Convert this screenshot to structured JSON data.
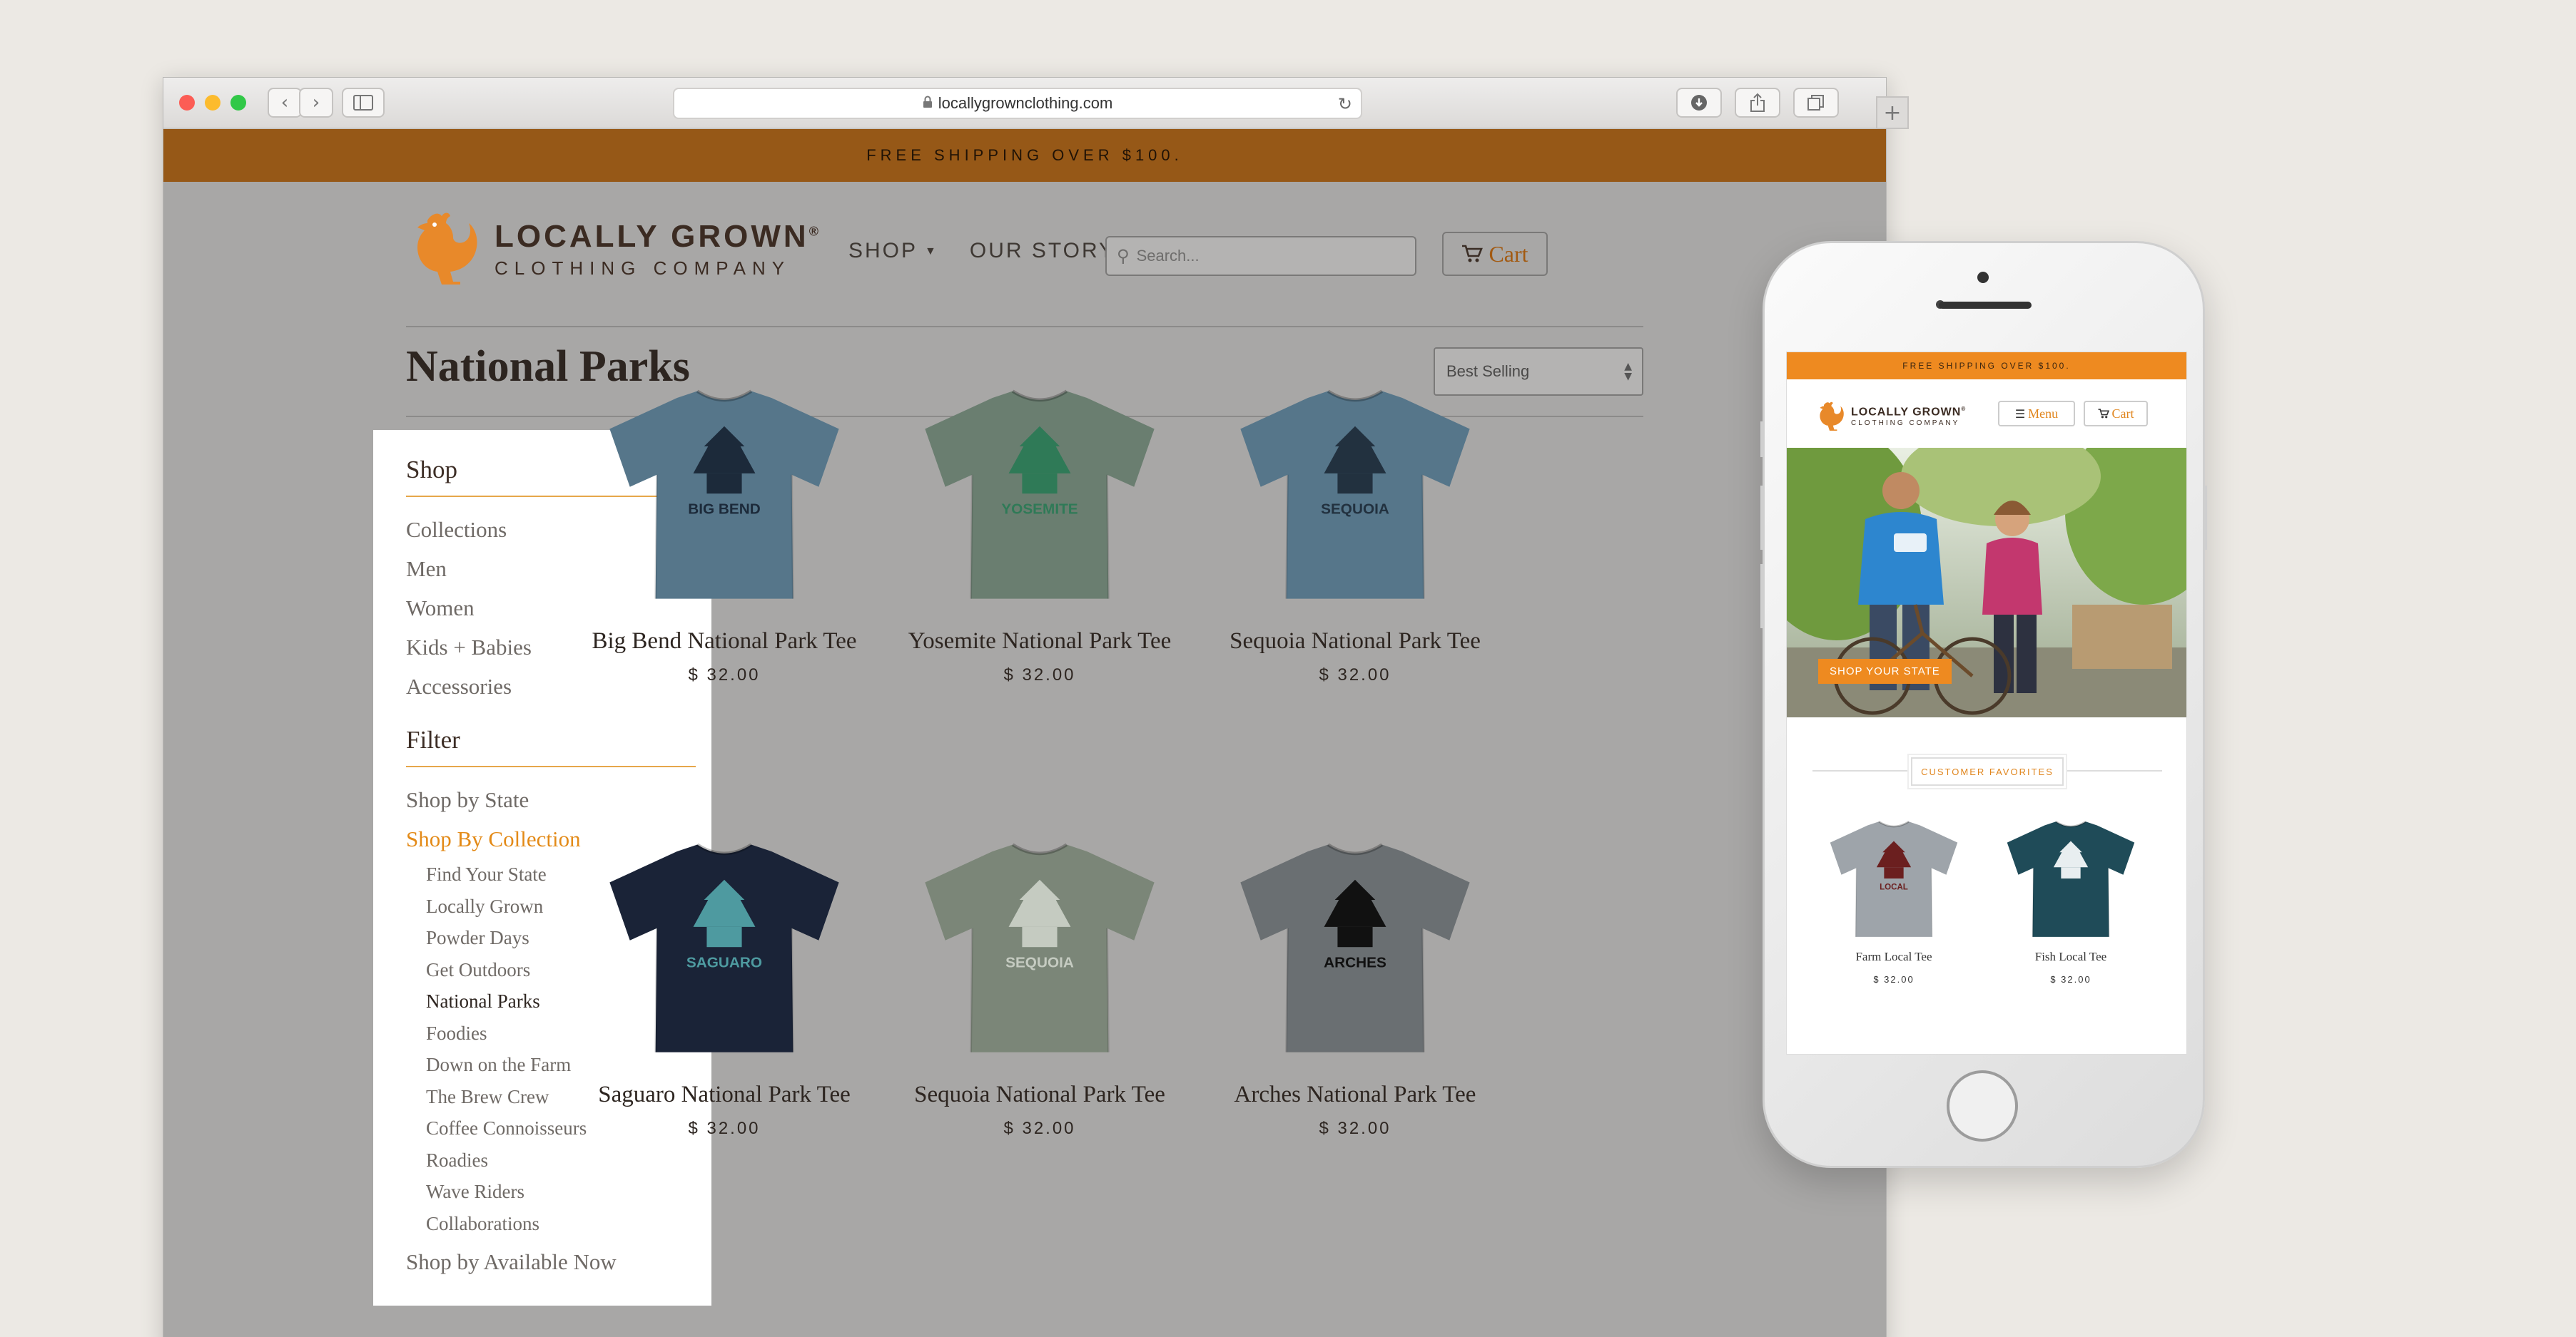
{
  "browser": {
    "url": "locallygrownclothing.com",
    "nav_back": "‹",
    "nav_forward": "›",
    "new_tab": "+"
  },
  "promo": "FREE SHIPPING OVER $100.",
  "brand": {
    "line1": "LOCALLY GROWN",
    "reg": "®",
    "line2": "CLOTHING COMPANY",
    "color": "#e8892a"
  },
  "nav": {
    "shop": "SHOP",
    "story": "OUR STORY",
    "search_placeholder": "Search...",
    "cart": "Cart"
  },
  "page_title": "National Parks",
  "sort": {
    "selected": "Best Selling"
  },
  "sidebar": {
    "shop_heading": "Shop",
    "shop_items": [
      "Collections",
      "Men",
      "Women",
      "Kids + Babies",
      "Accessories"
    ],
    "filter_heading": "Filter",
    "filter_state": "Shop by State",
    "filter_collection": "Shop By Collection",
    "collections": [
      "Find Your State",
      "Locally Grown",
      "Powder Days",
      "Get Outdoors",
      "National Parks",
      "Foodies",
      "Down on the Farm",
      "The Brew Crew",
      "Coffee Connoisseurs",
      "Roadies",
      "Wave Riders",
      "Collaborations"
    ],
    "filter_available": "Shop by Available Now"
  },
  "products": [
    {
      "name": "Big Bend National Park Tee",
      "price": "$ 32.00",
      "shirt_color": "#56768a",
      "print_color": "#1c2a3a",
      "print_text": "BIG BEND"
    },
    {
      "name": "Yosemite National Park Tee",
      "price": "$ 32.00",
      "shirt_color": "#6a7e70",
      "print_color": "#2f7a57",
      "print_text": "YOSEMITE"
    },
    {
      "name": "Sequoia National Park Tee",
      "price": "$ 32.00",
      "shirt_color": "#56768a",
      "print_color": "#22313f",
      "print_text": "SEQUOIA"
    },
    {
      "name": "Saguaro National Park Tee",
      "price": "$ 32.00",
      "shirt_color": "#1a2337",
      "print_color": "#4e9aa0",
      "print_text": "SAGUARO"
    },
    {
      "name": "Sequoia National Park Tee",
      "price": "$ 32.00",
      "shirt_color": "#7b8678",
      "print_color": "#c5cbc1",
      "print_text": "SEQUOIA"
    },
    {
      "name": "Arches National Park Tee",
      "price": "$ 32.00",
      "shirt_color": "#6a6f72",
      "print_color": "#111111",
      "print_text": "ARCHES"
    }
  ],
  "mobile": {
    "promo": "FREE SHIPPING OVER $100.",
    "menu": "Menu",
    "cart": "Cart",
    "hero_cta": "SHOP YOUR STATE",
    "section_title": "CUSTOMER FAVORITES",
    "products": [
      {
        "name": "Farm Local Tee",
        "price": "$ 32.00",
        "shirt_color": "#9ea4aa",
        "print_color": "#6b1f1f",
        "print_text": "LOCAL"
      },
      {
        "name": "Fish Local Tee",
        "price": "$ 32.00",
        "shirt_color": "#1f4b58",
        "print_color": "#e8eef0",
        "print_text": ""
      }
    ]
  }
}
